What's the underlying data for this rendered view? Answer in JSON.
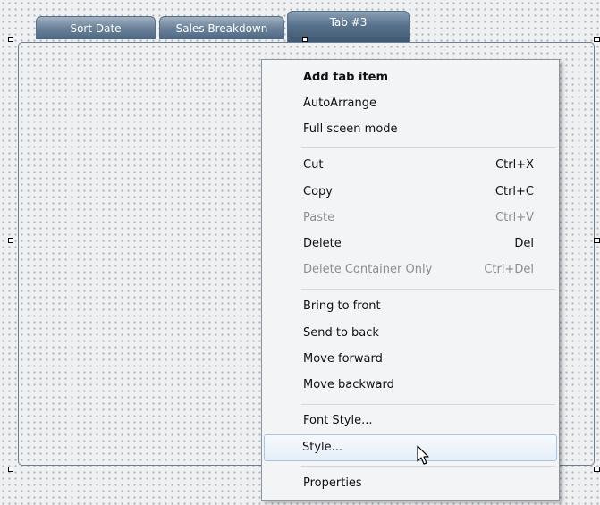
{
  "tabs": [
    {
      "label": "Sort Date",
      "active": false
    },
    {
      "label": "Sales Breakdown",
      "active": false
    },
    {
      "label": "Tab #3",
      "active": true
    }
  ],
  "context_menu": {
    "groups": [
      [
        {
          "label": "Add tab item",
          "shortcut": "",
          "bold": true,
          "disabled": false
        },
        {
          "label": "AutoArrange",
          "shortcut": "",
          "disabled": false
        },
        {
          "label": "Full sceen mode",
          "shortcut": "",
          "disabled": false
        }
      ],
      [
        {
          "label": "Cut",
          "shortcut": "Ctrl+X",
          "disabled": false
        },
        {
          "label": "Copy",
          "shortcut": "Ctrl+C",
          "disabled": false
        },
        {
          "label": "Paste",
          "shortcut": "Ctrl+V",
          "disabled": true
        },
        {
          "label": "Delete",
          "shortcut": "Del",
          "disabled": false
        },
        {
          "label": "Delete Container Only",
          "shortcut": "Ctrl+Del",
          "disabled": true
        }
      ],
      [
        {
          "label": "Bring to front",
          "shortcut": "",
          "disabled": false
        },
        {
          "label": "Send to back",
          "shortcut": "",
          "disabled": false
        },
        {
          "label": "Move forward",
          "shortcut": "",
          "disabled": false
        },
        {
          "label": "Move backward",
          "shortcut": "",
          "disabled": false
        }
      ],
      [
        {
          "label": "Font Style...",
          "shortcut": "",
          "disabled": false
        },
        {
          "label": "Style...",
          "shortcut": "",
          "disabled": false,
          "hovered": true
        }
      ],
      [
        {
          "label": "Properties",
          "shortcut": "",
          "disabled": false
        }
      ]
    ]
  },
  "cursor": {
    "icon": "arrow-pointer-icon"
  },
  "colors": {
    "tab_gradient_mid": "#6e869d",
    "menu_bg": "#f2f4f6",
    "hover_border": "#a9c4e3",
    "disabled_text": "#8d8d8d"
  }
}
